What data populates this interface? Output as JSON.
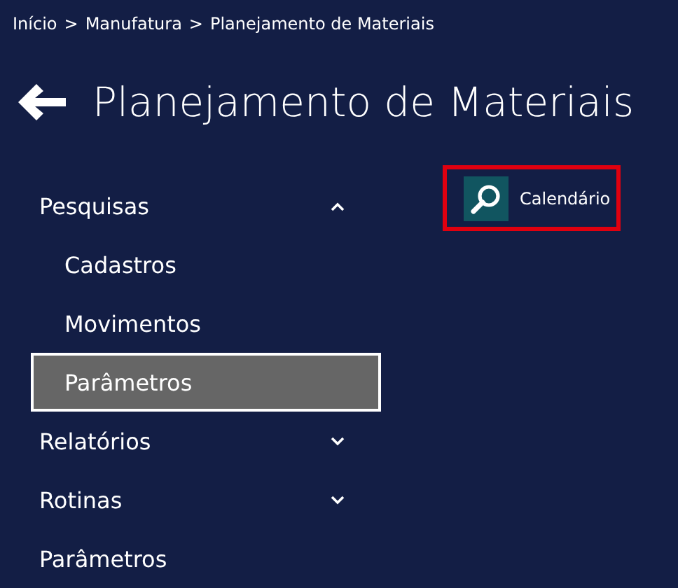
{
  "breadcrumb": {
    "items": [
      "Início",
      "Manufatura",
      "Planejamento de Materiais"
    ],
    "separator": ">"
  },
  "title": "Planejamento de Materiais",
  "menu": [
    {
      "kind": "group",
      "label": "Pesquisas",
      "expanded": true,
      "selected": false,
      "children": [
        {
          "label": "Cadastros",
          "selected": false
        },
        {
          "label": "Movimentos",
          "selected": false
        },
        {
          "label": "Parâmetros",
          "selected": true
        }
      ]
    },
    {
      "kind": "group",
      "label": "Relatórios",
      "expanded": false,
      "selected": false
    },
    {
      "kind": "group",
      "label": "Rotinas",
      "expanded": false,
      "selected": false
    },
    {
      "kind": "link",
      "label": "Parâmetros",
      "selected": false
    }
  ],
  "tiles": [
    {
      "label": "Calendário",
      "highlighted": true
    }
  ]
}
